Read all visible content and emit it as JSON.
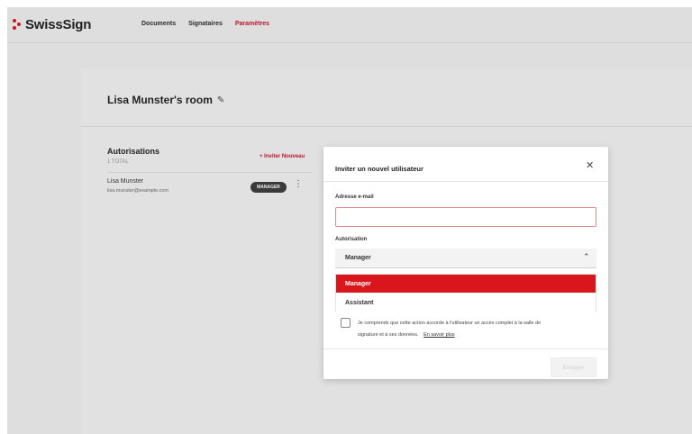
{
  "app": {
    "logo_text": "SwissSign",
    "brand_color": "#d9161c"
  },
  "nav": {
    "items": [
      {
        "label": "Documents"
      },
      {
        "label": "Signataires"
      },
      {
        "label": "Paramètres",
        "active": true
      }
    ]
  },
  "room": {
    "title": "Lisa Munster's room",
    "edit_icon": "pencil-icon"
  },
  "permissions": {
    "title": "Autorisations",
    "count": "1 TOTAL",
    "invite_label": "+ Inviter Nouveau",
    "users": [
      {
        "name": "Lisa Munster",
        "email": "lisa.munster@example.com",
        "role": "MANAGER"
      }
    ]
  },
  "modal": {
    "title": "Inviter un nouvel utilisateur",
    "close_icon": "close-icon",
    "email_label": "Adresse e-mail",
    "email_value": "",
    "authorization_label": "Autorisation",
    "selected": "Manager",
    "options": [
      {
        "label": "Manager",
        "highlighted": true
      },
      {
        "label": "Assistant"
      }
    ],
    "consent_line1": "Je comprends que cette action accorde à l'utilisateur un accès complet à la salle de",
    "consent_line2": "signature et à ses données.",
    "learn_more": "En savoir plus",
    "submit_label": "Envoyer"
  }
}
